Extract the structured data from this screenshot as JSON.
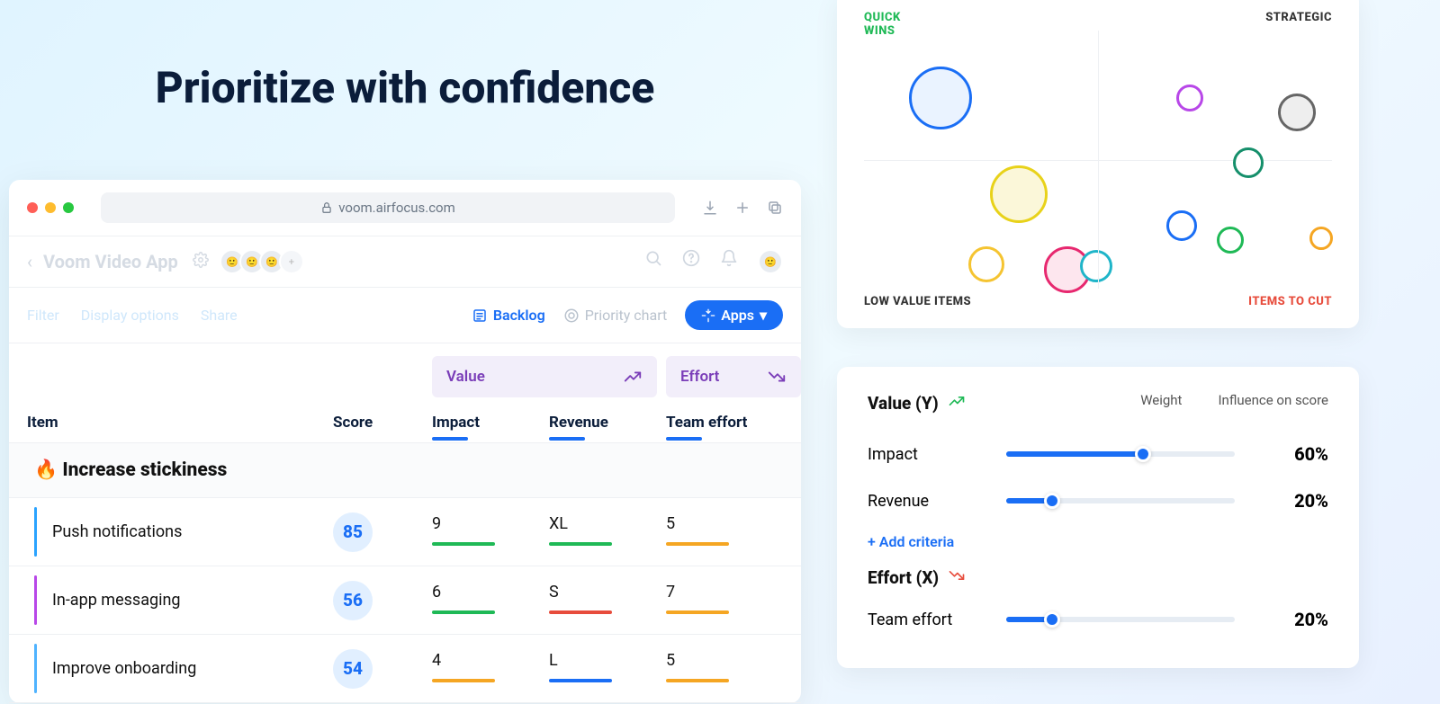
{
  "headline": "Prioritize with confidence",
  "browser": {
    "url": "voom.airfocus.com"
  },
  "app": {
    "title": "Voom Video App"
  },
  "toolbar": {
    "filter": "Filter",
    "display_options": "Display options",
    "share": "Share",
    "backlog": "Backlog",
    "priority_chart": "Priority chart",
    "apps": "Apps"
  },
  "col_groups": {
    "value": "Value",
    "effort": "Effort"
  },
  "columns": {
    "item": "Item",
    "score": "Score",
    "impact": "Impact",
    "revenue": "Revenue",
    "team_effort": "Team effort"
  },
  "section": "🔥 Increase stickiness",
  "rows": [
    {
      "name": "Push notifications",
      "score": "85",
      "impact": "9",
      "revenue": "XL",
      "effort": "5",
      "impact_c": "green",
      "revenue_c": "green",
      "effort_c": "orange"
    },
    {
      "name": "In-app messaging",
      "score": "56",
      "impact": "6",
      "revenue": "S",
      "effort": "7",
      "impact_c": "green",
      "revenue_c": "red",
      "effort_c": "orange"
    },
    {
      "name": "Improve onboarding",
      "score": "54",
      "impact": "4",
      "revenue": "L",
      "effort": "5",
      "impact_c": "orange",
      "revenue_c": "blue",
      "effort_c": "orange"
    }
  ],
  "chart": {
    "quad_tl": "QUICK WINS",
    "quad_tr": "STRATEGIC",
    "quad_bl": "LOW VALUE ITEMS",
    "quad_br": "ITEMS TO CUT"
  },
  "criteria": {
    "value_label": "Value (Y)",
    "weight_label": "Weight",
    "influence_label": "Influence on score",
    "impact": {
      "name": "Impact",
      "pct": "60%",
      "fill": 60
    },
    "revenue": {
      "name": "Revenue",
      "pct": "20%",
      "fill": 20
    },
    "add": "+ Add criteria",
    "effort_label": "Effort (X)",
    "team_effort": {
      "name": "Team effort",
      "pct": "20%",
      "fill": 20
    }
  },
  "chart_data": {
    "type": "scatter",
    "title": "Priority chart",
    "xlabel": "Effort",
    "ylabel": "Value",
    "xlim": [
      0,
      10
    ],
    "ylim": [
      0,
      10
    ],
    "quadrants": {
      "top_left": "QUICK WINS",
      "top_right": "STRATEGIC",
      "bottom_left": "LOW VALUE ITEMS",
      "bottom_right": "ITEMS TO CUT"
    },
    "series": [
      {
        "x": 1.5,
        "y": 8.5,
        "size": 70,
        "color": "#1a6ef5"
      },
      {
        "x": 3.2,
        "y": 5.0,
        "size": 64,
        "color": "#e8d21a"
      },
      {
        "x": 2.6,
        "y": 2.0,
        "size": 40,
        "color": "#f5c431"
      },
      {
        "x": 4.2,
        "y": 1.8,
        "size": 52,
        "color": "#e7286f"
      },
      {
        "x": 5.0,
        "y": 1.8,
        "size": 36,
        "color": "#1fb5c9"
      },
      {
        "x": 6.9,
        "y": 8.0,
        "size": 30,
        "color": "#b847e8"
      },
      {
        "x": 6.8,
        "y": 3.4,
        "size": 34,
        "color": "#1a6ef5"
      },
      {
        "x": 7.8,
        "y": 2.8,
        "size": 30,
        "color": "#1fb956"
      },
      {
        "x": 8.1,
        "y": 5.8,
        "size": 34,
        "color": "#158f6b"
      },
      {
        "x": 9.0,
        "y": 7.6,
        "size": 42,
        "color": "#666666"
      },
      {
        "x": 9.6,
        "y": 2.8,
        "size": 26,
        "color": "#f5a623"
      }
    ]
  }
}
